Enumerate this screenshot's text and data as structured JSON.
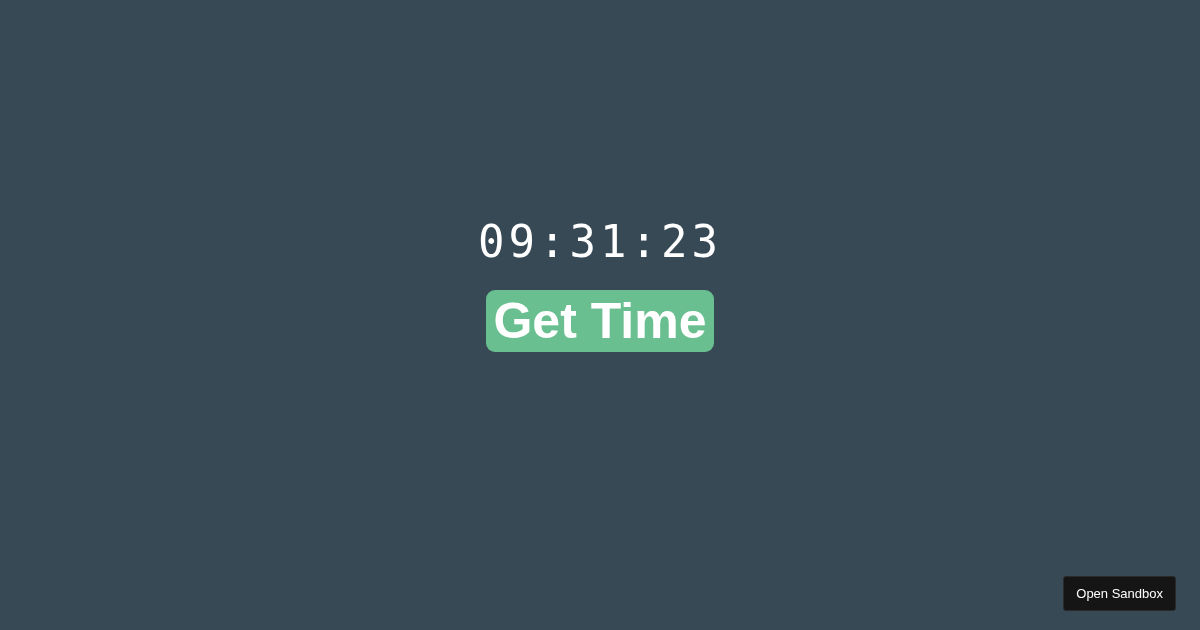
{
  "clock": {
    "time": "09:31:23"
  },
  "buttons": [
    {
      "kind": "primary",
      "label": "Get Time"
    },
    {
      "kind": "sandbox",
      "label": "Open Sandbox"
    }
  ]
}
